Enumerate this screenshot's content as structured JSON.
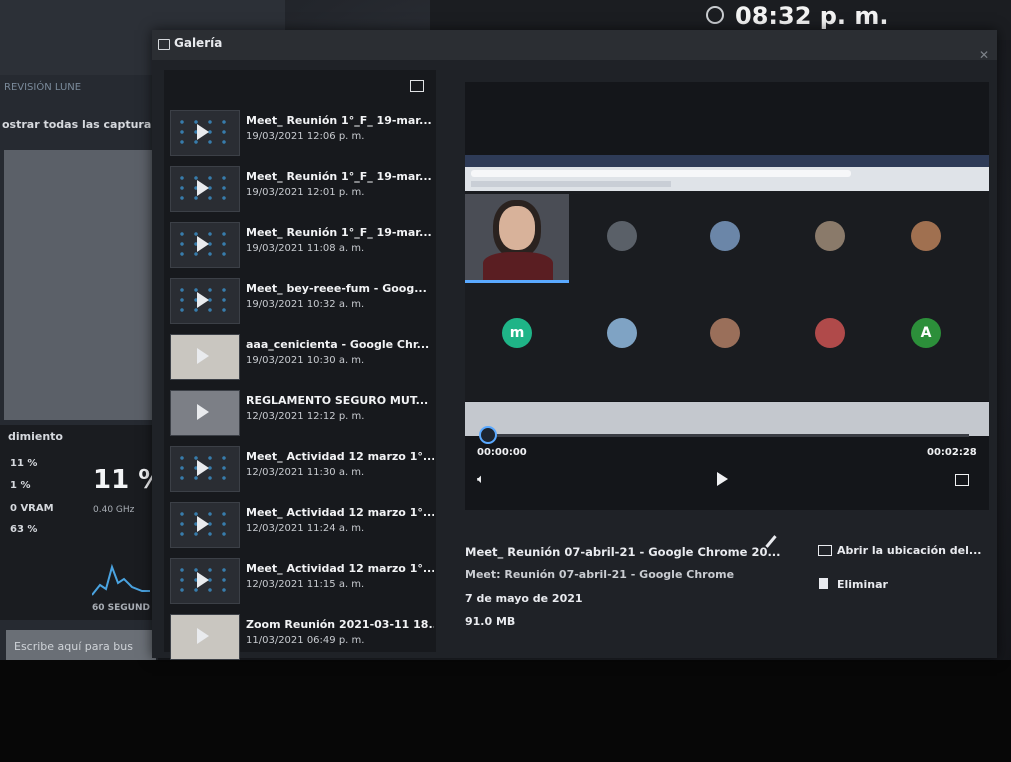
{
  "desktop": {
    "clock": "08:32 p. m.",
    "banner": "REVISIÓN LUNE",
    "show_all": "ostrar todas las captura",
    "performance": {
      "heading": "dimiento",
      "row1": "11 %",
      "row2": "1 %",
      "row3": "0 VRAM",
      "row4": "63 %",
      "big_percent": "11 %",
      "ghz": "0.40 GHz",
      "seconds": "60 SEGUND"
    },
    "search_placeholder": "Escribe aquí para bus"
  },
  "gallery": {
    "title": "Galería",
    "items": [
      {
        "title": "Meet_ Reunión 1°_F_ 19-mar...",
        "date": "19/03/2021 12:06 p. m."
      },
      {
        "title": "Meet_ Reunión 1°_F_ 19-mar...",
        "date": "19/03/2021 12:01 p. m."
      },
      {
        "title": "Meet_ Reunión 1°_F_ 19-mar...",
        "date": "19/03/2021 11:08 a. m."
      },
      {
        "title": "Meet_ bey-reee-fum - Goog...",
        "date": "19/03/2021 10:32 a. m."
      },
      {
        "title": "aaa_cenicienta - Google Chr...",
        "date": "19/03/2021 10:30 a. m."
      },
      {
        "title": "REGLAMENTO SEGURO MUT...",
        "date": "12/03/2021 12:12 p. m."
      },
      {
        "title": "Meet_ Actividad 12 marzo 1°...",
        "date": "12/03/2021 11:30 a. m."
      },
      {
        "title": "Meet_ Actividad 12 marzo 1°...",
        "date": "12/03/2021 11:24 a. m."
      },
      {
        "title": "Meet_ Actividad 12 marzo 1°...",
        "date": "12/03/2021 11:15 a. m."
      },
      {
        "title": "Zoom Reunión 2021-03-11 18...",
        "date": "11/03/2021 06:49 p. m."
      }
    ],
    "player": {
      "current_time": "00:00:00",
      "total_time": "00:02:28",
      "progress": 0.0
    },
    "participants": {
      "letter_m": "m",
      "letter_a": "A",
      "color_m": "#1fb487",
      "color_a": "#2c8f3a"
    },
    "details": {
      "filename": "Meet_ Reunión 07-abril-21 - Google Chrome 20...",
      "source": "Meet: Reunión 07-abril-21 - Google Chrome",
      "date": "7 de mayo de 2021",
      "size": "91.0 MB"
    },
    "actions": {
      "open_location": "Abrir la ubicación del...",
      "delete": "Eliminar"
    }
  }
}
